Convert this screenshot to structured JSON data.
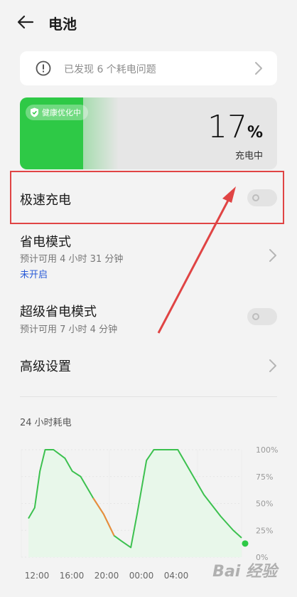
{
  "header": {
    "title": "电池"
  },
  "issues": {
    "text": "已发现 6 个耗电问题"
  },
  "battery": {
    "badge": "健康优化中",
    "percent": "17",
    "percent_sign": "%",
    "status": "充电中",
    "level": 0.17,
    "fill_color": "#2ec946"
  },
  "fast_charge": {
    "label": "极速充电",
    "enabled": false
  },
  "power_saving": {
    "label": "省电模式",
    "estimate": "预计可用 4 小时 31 分钟",
    "status": "未开启",
    "status_color": "#2a5bd7"
  },
  "super_saving": {
    "label": "超级省电模式",
    "estimate": "预计可用 7 小时 4 分钟",
    "enabled": false
  },
  "advanced": {
    "label": "高级设置"
  },
  "chart_title": "24 小时耗电",
  "chart_data": {
    "type": "area",
    "title": "24 小时耗电",
    "x_ticks": [
      "12:00",
      "16:00",
      "20:00",
      "00:00",
      "04:00"
    ],
    "y_ticks": [
      "100%",
      "75%",
      "50%",
      "25%",
      "0%"
    ],
    "ylim": [
      0,
      100
    ],
    "x_unit": "hours since 10:30",
    "x": [
      0,
      0.6,
      1.1,
      1.6,
      2.4,
      3.5,
      4.2,
      5.0,
      6.2,
      7.2,
      8.2,
      8.9,
      9.8,
      10.4,
      11.3,
      12.0,
      14.3,
      16.8,
      18.4,
      19.6,
      20.4
    ],
    "values": [
      36,
      46,
      80,
      100,
      100,
      92,
      80,
      75,
      55,
      40,
      20,
      15,
      9,
      40,
      90,
      100,
      100,
      58,
      38,
      25,
      18
    ],
    "color": "#3cc14f",
    "highlight_color": "#f08a3c"
  },
  "watermark": "Bai 经验"
}
